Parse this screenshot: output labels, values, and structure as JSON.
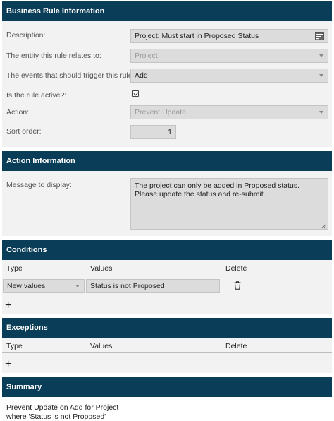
{
  "business_rule": {
    "header": "Business Rule Information",
    "description_label": "Description:",
    "description_value": "Project:  Must start in Proposed Status",
    "entity_label": "The entity this rule relates to:",
    "entity_value": "Project",
    "events_label": "The events that should trigger this rule:",
    "events_value": "Add",
    "active_label": "Is the rule active?:",
    "active_checked": true,
    "action_label": "Action:",
    "action_value": "Prevent Update",
    "sort_label": "Sort order:",
    "sort_value": "1"
  },
  "action_info": {
    "header": "Action Information",
    "message_label": "Message to display:",
    "message_value": "The project can only be added in Proposed status.  Please update the status and re-submit."
  },
  "conditions": {
    "header": "Conditions",
    "col_type": "Type",
    "col_values": "Values",
    "col_delete": "Delete",
    "rows": [
      {
        "type": "New values",
        "value": "Status is not Proposed"
      }
    ],
    "add_label": "+"
  },
  "exceptions": {
    "header": "Exceptions",
    "col_type": "Type",
    "col_values": "Values",
    "col_delete": "Delete",
    "add_label": "+"
  },
  "summary": {
    "header": "Summary",
    "line1": "Prevent Update on Add for Project",
    "line2": "where 'Status is not Proposed'"
  },
  "icons": {
    "description_field_icon": "text-expand-icon",
    "delete_row_icon": "trash-icon",
    "dropdown_icon": "caret-down-icon"
  },
  "colors": {
    "header_bg": "#0a3d57",
    "panel_bg": "#f2f2f2",
    "field_bg": "#dcdcdc"
  }
}
